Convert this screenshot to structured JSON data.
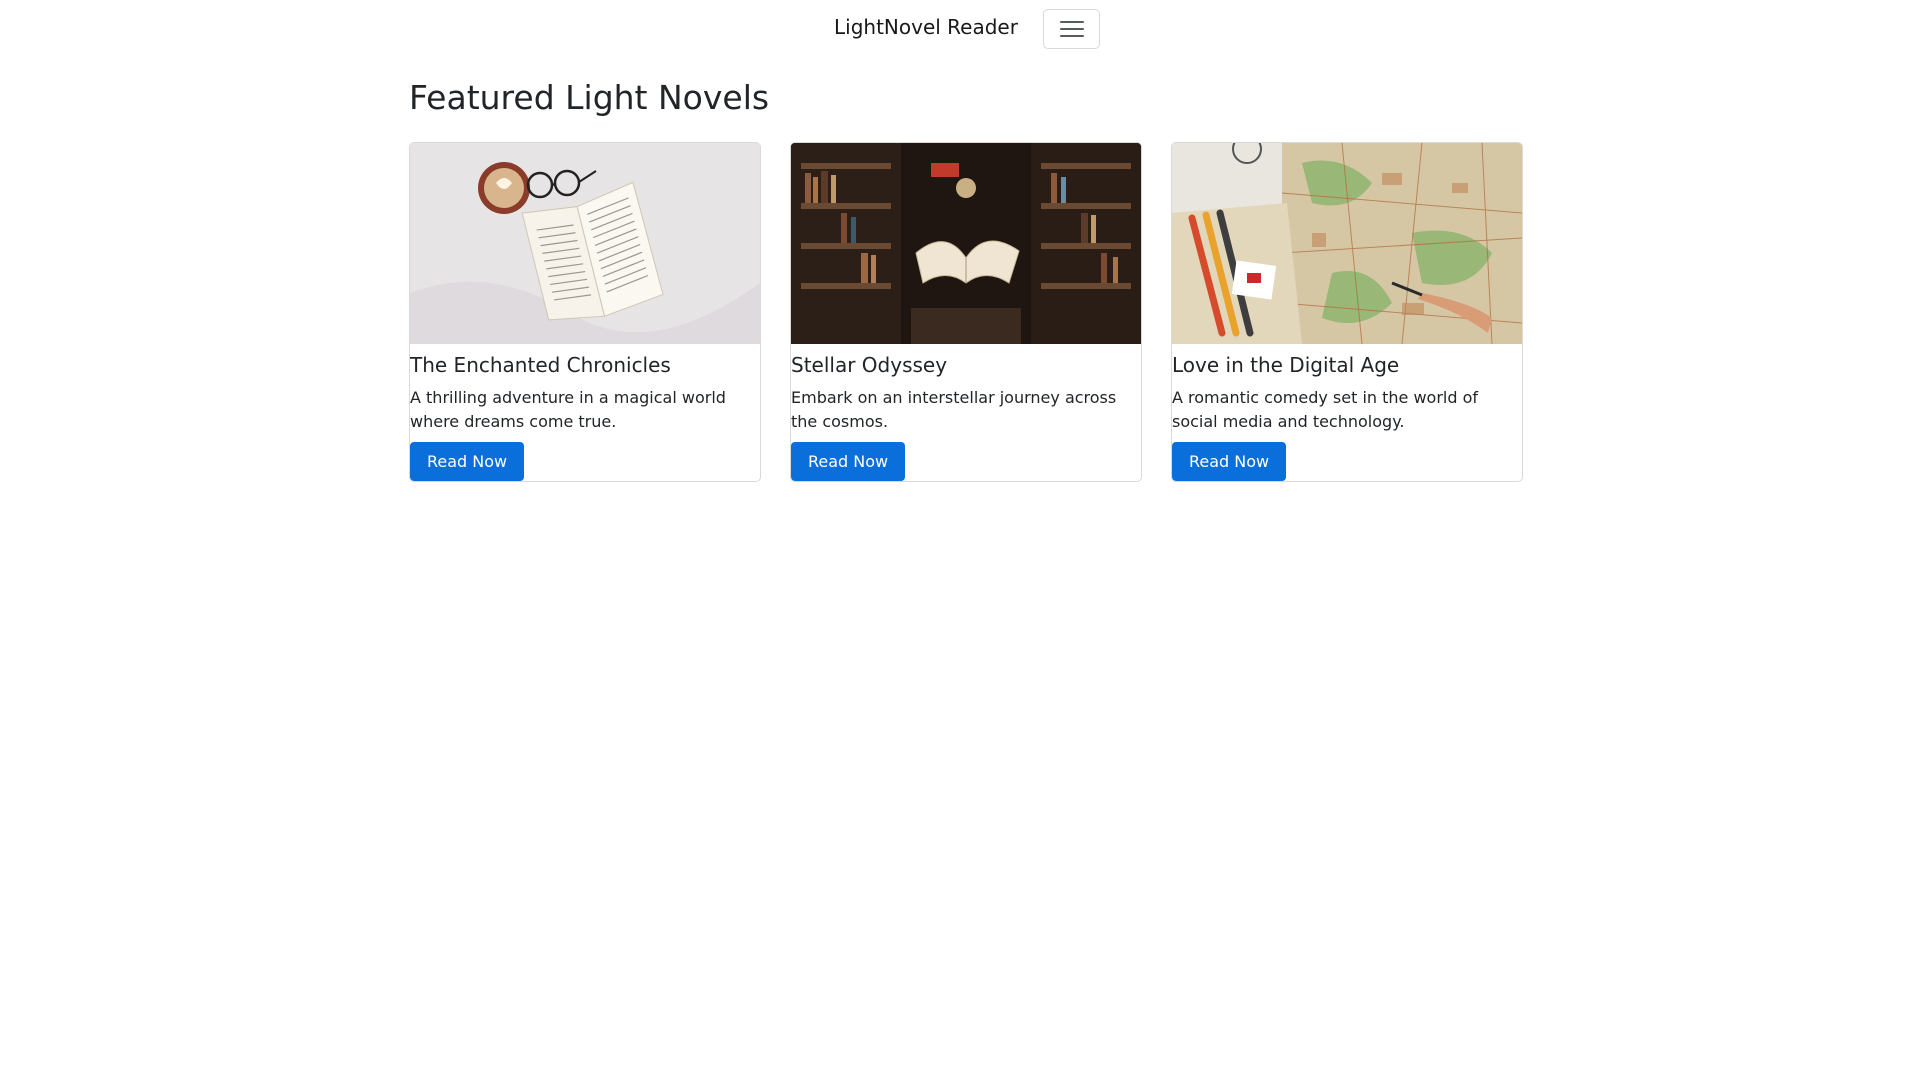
{
  "navbar": {
    "brand": "LightNovel Reader",
    "toggler_icon": "hamburger-menu-icon"
  },
  "main": {
    "title": "Featured Light Novels",
    "cards": [
      {
        "title": "The Enchanted Chronicles",
        "description": "A thrilling adventure in a magical world where dreams come true.",
        "button_label": "Read Now"
      },
      {
        "title": "Stellar Odyssey",
        "description": "Embark on an interstellar journey across the cosmos.",
        "button_label": "Read Now"
      },
      {
        "title": "Love in the Digital Age",
        "description": "A romantic comedy set in the world of social media and technology.",
        "button_label": "Read Now"
      }
    ]
  },
  "colors": {
    "primary_button": "#0a6fdb",
    "text": "#212529"
  }
}
